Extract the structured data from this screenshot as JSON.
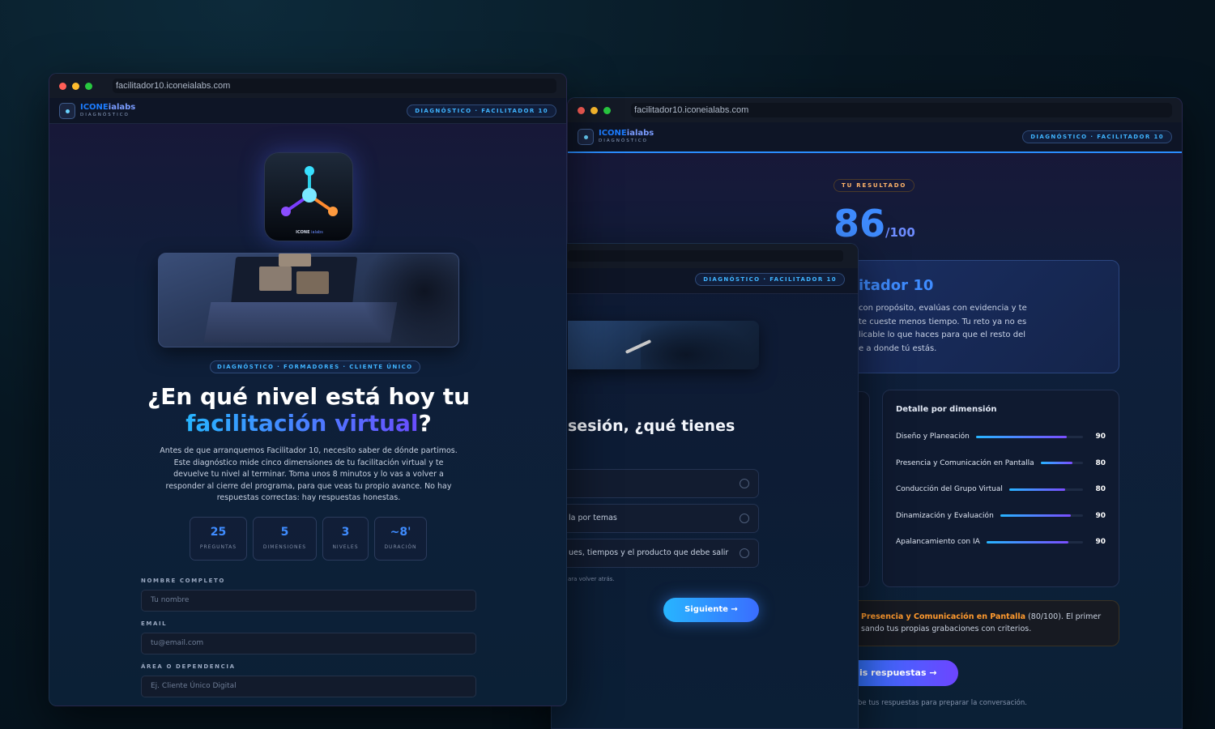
{
  "url": "facilitador10.iconeialabs.com",
  "brand": {
    "part1": "ICONE",
    "part2": "ialabs",
    "sub": "DIAGNÓSTICO"
  },
  "header_pill": "DIAGNÓSTICO · FACILITADOR 10",
  "back_pill": "DIAGNÓSTICO · FACILITADOR 10",
  "app_icon_text": "ICONE",
  "app_icon_text2": "ialabs",
  "intro": {
    "tag": "DIAGNÓSTICO · FORMADORES · CLIENTE ÚNICO",
    "title_line1": "¿En qué nivel está hoy tu",
    "title_accent": "facilitación virtual",
    "title_end": "?",
    "body": "Antes de que arranquemos Facilitador 10, necesito saber de dónde partimos. Este diagnóstico mide cinco dimensiones de tu facilitación virtual y te devuelve tu nivel al terminar. Toma unos 8 minutos y lo vas a volver a responder al cierre del programa, para que veas tu propio avance. No hay respuestas correctas: hay respuestas honestas.",
    "stats": [
      {
        "value": "25",
        "label": "PREGUNTAS"
      },
      {
        "value": "5",
        "label": "DIMENSIONES"
      },
      {
        "value": "3",
        "label": "NIVELES"
      },
      {
        "value": "~8'",
        "label": "DURACIÓN"
      }
    ],
    "fields": [
      {
        "label": "NOMBRE COMPLETO",
        "placeholder": "Tu nombre"
      },
      {
        "label": "EMAIL",
        "placeholder": "tu@email.com"
      },
      {
        "label": "ÁREA O DEPENDENCIA",
        "placeholder": "Ej. Cliente Único Digital"
      }
    ]
  },
  "question": {
    "title": "sesión, ¿qué tienes",
    "options": [
      "",
      "la por temas",
      "ues, tiempos y el producto que debe salir"
    ],
    "hint": "ara volver atrás.",
    "next": "Siguiente →"
  },
  "result": {
    "tag": "TU RESULTADO",
    "score": "86",
    "score_max": "/100",
    "level_title": "itador 10",
    "level_text": [
      "con propósito, evalúas con evidencia y te",
      " te cueste menos tiempo. Tu reto ya no es",
      "licable lo que haces para que el resto del",
      "e a donde tú estás."
    ],
    "detail_title": "Detalle por dimensión",
    "dimensions": [
      {
        "name": "Diseño y Planeación",
        "score": 90
      },
      {
        "name": "Presencia y Comunicación en Pantalla",
        "score": 80
      },
      {
        "name": "Conducción del Grupo Virtual",
        "score": 80
      },
      {
        "name": "Dinamización y Evaluación",
        "score": 90
      },
      {
        "name": "Apalancamiento con IA",
        "score": 90
      }
    ],
    "rec_strong": "Presencia y Comunicación en Pantalla",
    "rec_rest": " (80/100). El primer",
    "rec_line2": "sando tus propias grabaciones con criterios.",
    "cta": "is respuestas →",
    "footnote": "be tus respuestas para preparar la conversación."
  },
  "colors": {
    "accent": "#3f8cff",
    "cyan": "#27b5ff",
    "violet": "#7a4dff",
    "orange": "#ff9a2e"
  }
}
